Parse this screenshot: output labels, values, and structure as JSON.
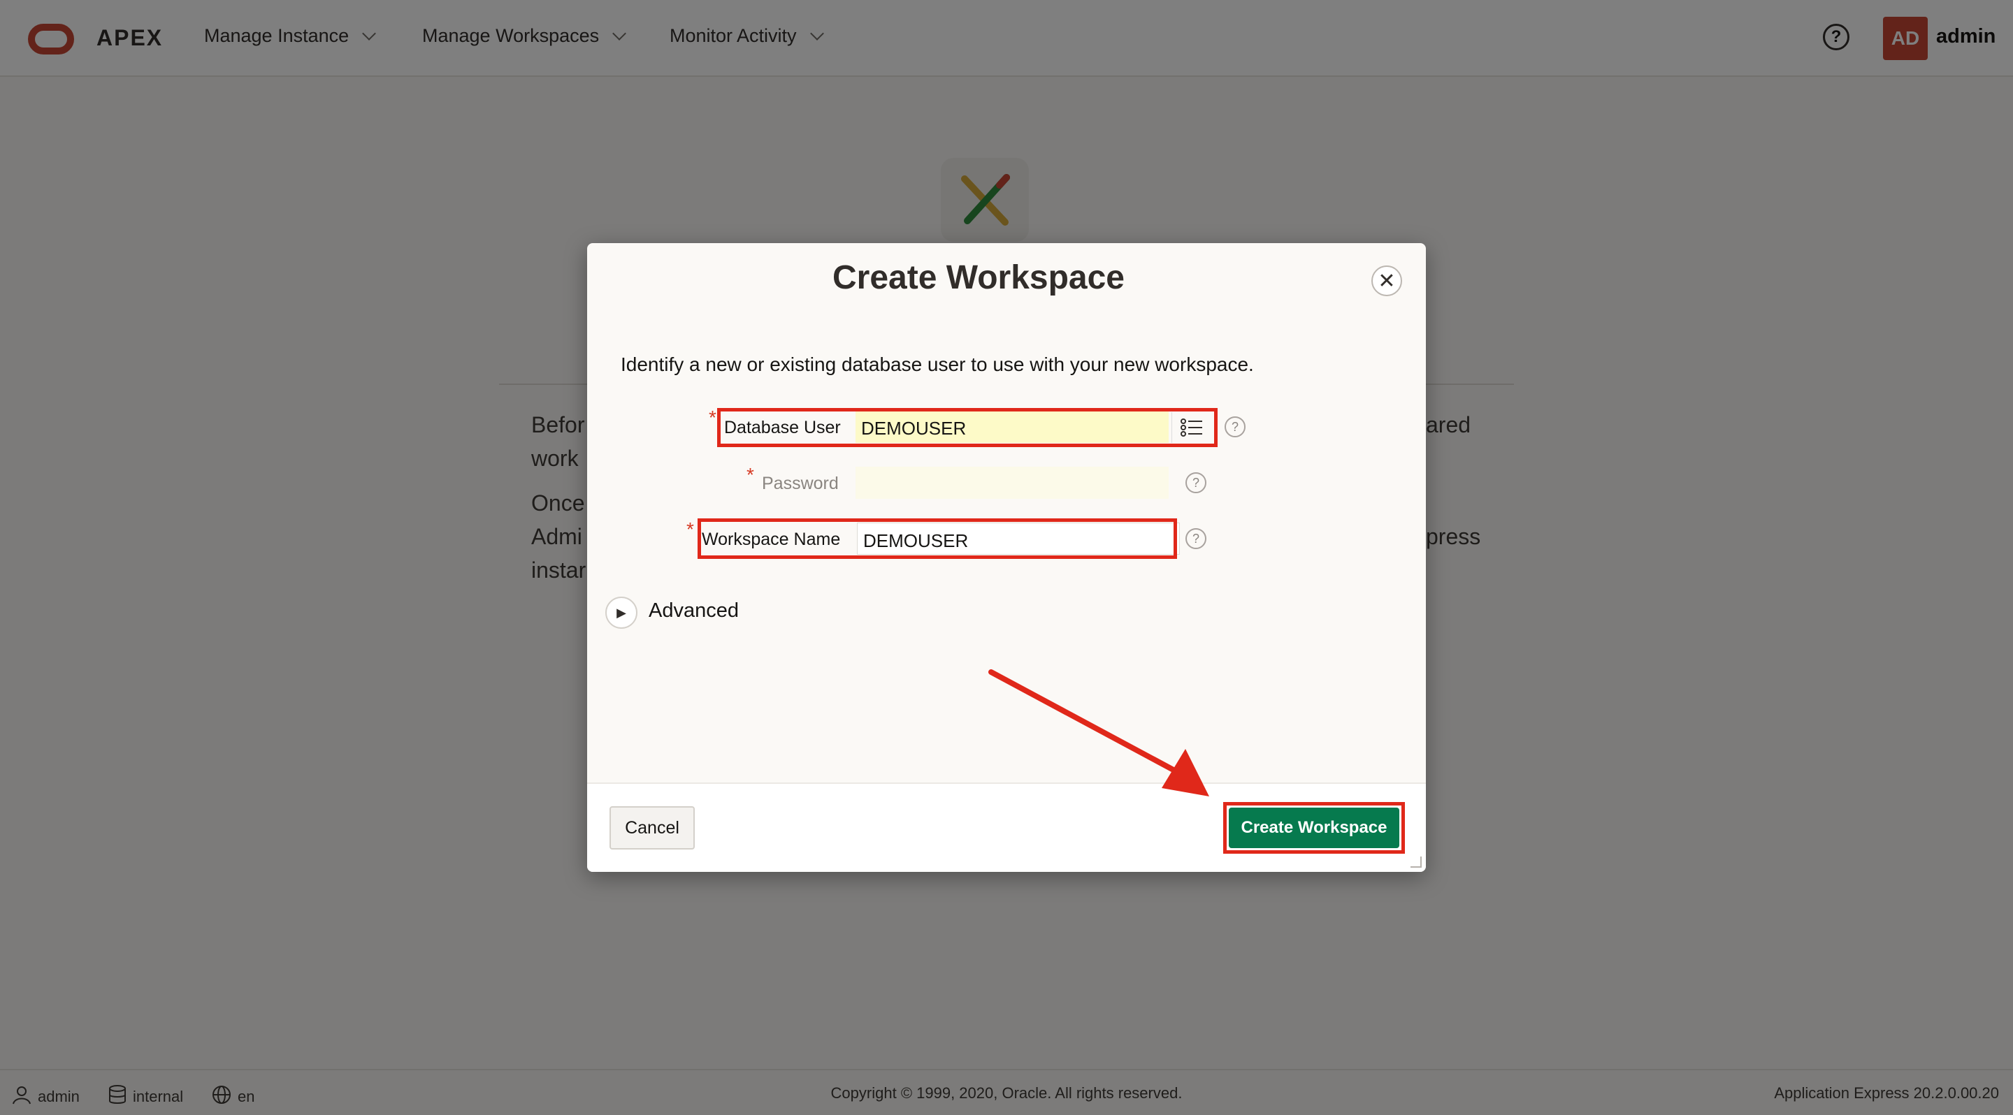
{
  "header": {
    "app_name": "APEX",
    "nav": [
      "Manage Instance",
      "Manage Workspaces",
      "Monitor Activity"
    ],
    "help_symbol": "?",
    "avatar_initials": "AD",
    "user": "admin"
  },
  "background_page": {
    "line1_left": "Befor",
    "line1_right": "ared",
    "line2_left": "work",
    "line3_left": "Once",
    "line4_left": "Admi",
    "line4_right": "press",
    "line5_left": "instar"
  },
  "dialog": {
    "title": "Create Workspace",
    "close_symbol": "✕",
    "intro": "Identify a new or existing database user to use with your new workspace.",
    "fields": {
      "database_user": {
        "label": "Database User",
        "value": "DEMOUSER",
        "required": true
      },
      "password": {
        "label": "Password",
        "value": "",
        "required": true
      },
      "workspace_name": {
        "label": "Workspace Name",
        "value": "DEMOUSER",
        "required": true
      }
    },
    "required_marker": "*",
    "help_symbol": "?",
    "advanced_label": "Advanced",
    "cancel_label": "Cancel",
    "create_label": "Create Workspace"
  },
  "footer": {
    "user": "admin",
    "workspace": "internal",
    "language": "en",
    "copyright": "Copyright © 1999, 2020, Oracle. All rights reserved.",
    "version": "Application Express 20.2.0.00.20"
  },
  "colors": {
    "brand": "#c74634",
    "primary_button": "#067a4e",
    "annotation": "#e0281a"
  }
}
